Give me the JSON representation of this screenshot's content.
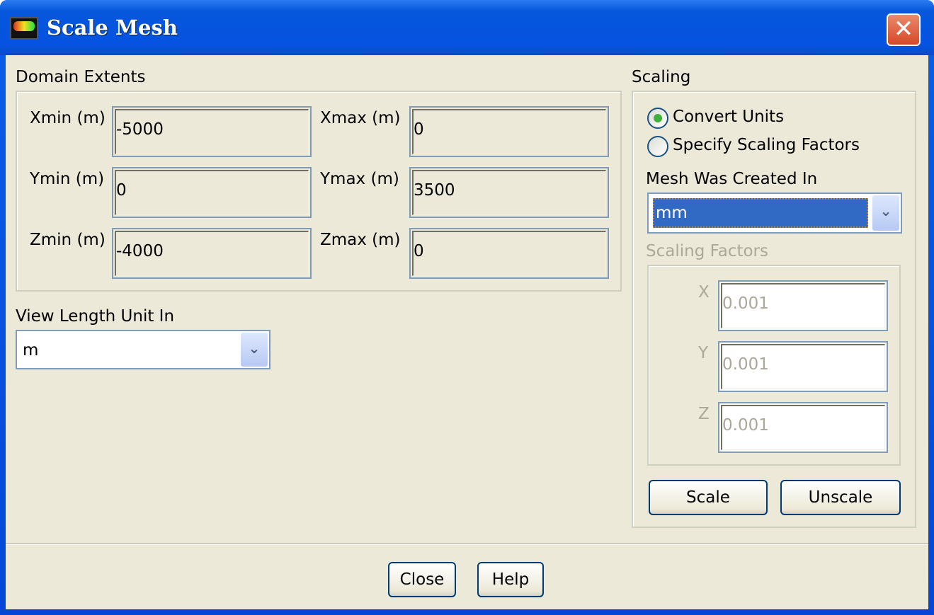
{
  "window": {
    "title": "Scale Mesh",
    "close_glyph": "✕"
  },
  "domain_extents": {
    "label": "Domain Extents",
    "fields": [
      {
        "label": "Xmin (m)",
        "value": "-5000"
      },
      {
        "label": "Xmax (m)",
        "value": "0"
      },
      {
        "label": "Ymin (m)",
        "value": "0"
      },
      {
        "label": "Ymax (m)",
        "value": "3500"
      },
      {
        "label": "Zmin (m)",
        "value": "-4000"
      },
      {
        "label": "Zmax (m)",
        "value": "0"
      }
    ]
  },
  "view_length": {
    "label": "View Length Unit In",
    "value": "m"
  },
  "scaling": {
    "label": "Scaling",
    "options": [
      {
        "label": "Convert Units",
        "selected": true
      },
      {
        "label": "Specify Scaling Factors",
        "selected": false
      }
    ],
    "mesh_created_label": "Mesh Was Created In",
    "mesh_created_value": "mm",
    "factors_label": "Scaling Factors",
    "factors": [
      {
        "label": "X",
        "value": "0.001"
      },
      {
        "label": "Y",
        "value": "0.001"
      },
      {
        "label": "Z",
        "value": "0.001"
      }
    ],
    "scale_button": "Scale",
    "unscale_button": "Unscale"
  },
  "footer": {
    "close": "Close",
    "help": "Help"
  }
}
